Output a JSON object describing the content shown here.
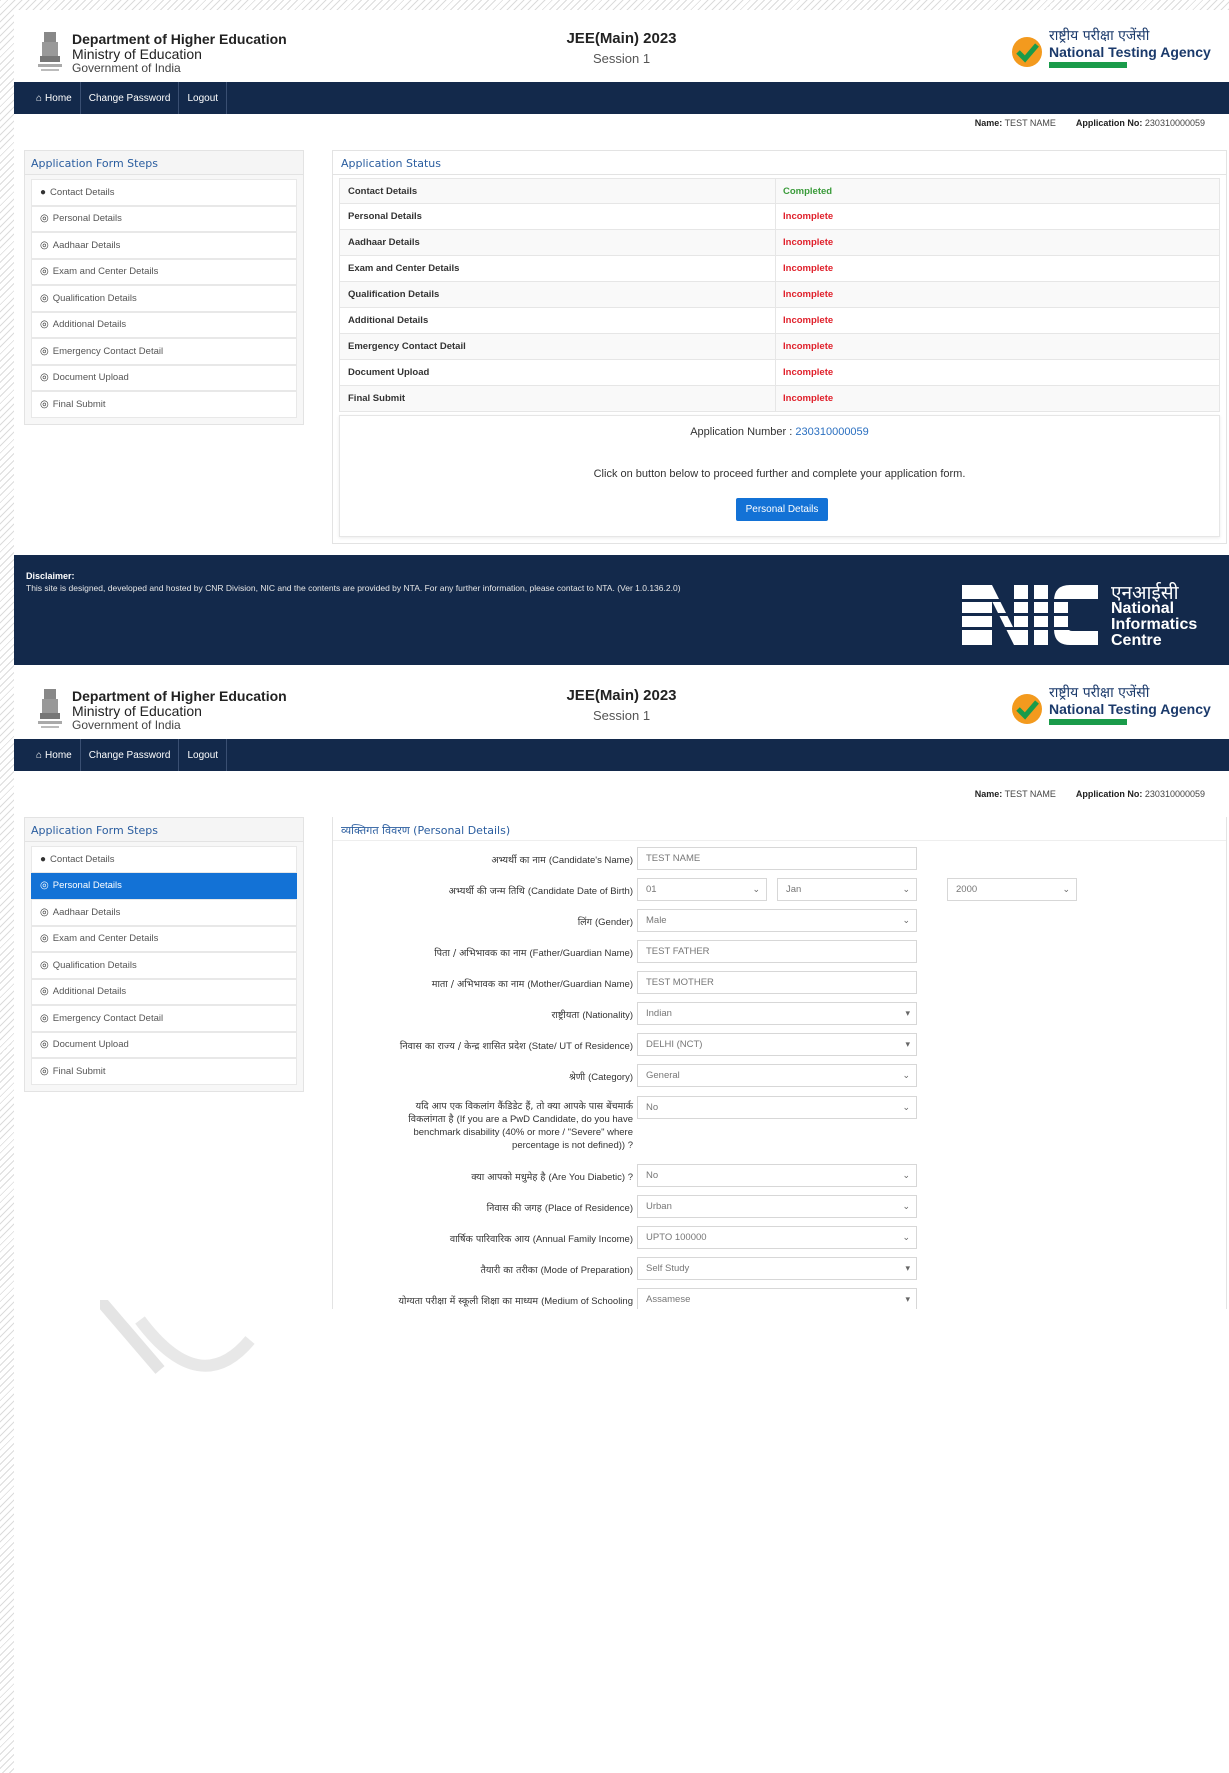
{
  "header": {
    "dept_line1": "Department of Higher Education",
    "dept_line2": "Ministry of Education",
    "dept_line3": "Government of India",
    "exam_title": "JEE(Main) 2023",
    "exam_session": "Session 1",
    "nta_hindi": "राष्ट्रीय परीक्षा एजेंसी",
    "nta_english": "National Testing Agency"
  },
  "nav": {
    "home": "Home",
    "change_password": "Change Password",
    "logout": "Logout"
  },
  "user": {
    "name_label": "Name:",
    "name_value": "TEST NAME",
    "app_no_label": "Application No:",
    "app_no_value": "230310000059"
  },
  "sidebar": {
    "title": "Application Form Steps",
    "items": [
      {
        "label": "Contact Details"
      },
      {
        "label": "Personal Details"
      },
      {
        "label": "Aadhaar Details"
      },
      {
        "label": "Exam and Center Details"
      },
      {
        "label": "Qualification Details"
      },
      {
        "label": "Additional Details"
      },
      {
        "label": "Emergency Contact Detail"
      },
      {
        "label": "Document Upload"
      },
      {
        "label": "Final Submit"
      }
    ]
  },
  "status": {
    "title": "Application Status",
    "rows": [
      {
        "step": "Contact Details",
        "state": "Completed"
      },
      {
        "step": "Personal Details",
        "state": "Incomplete"
      },
      {
        "step": "Aadhaar Details",
        "state": "Incomplete"
      },
      {
        "step": "Exam and Center Details",
        "state": "Incomplete"
      },
      {
        "step": "Qualification Details",
        "state": "Incomplete"
      },
      {
        "step": "Additional Details",
        "state": "Incomplete"
      },
      {
        "step": "Emergency Contact Detail",
        "state": "Incomplete"
      },
      {
        "step": "Document Upload",
        "state": "Incomplete"
      },
      {
        "step": "Final Submit",
        "state": "Incomplete"
      }
    ],
    "app_number_label": "Application Number :",
    "app_number_value": "230310000059",
    "instruction": "Click on button below to proceed further and complete your application form.",
    "button_label": "Personal Details"
  },
  "footer": {
    "disclaimer_title": "Disclaimer:",
    "disclaimer_text": "This site is designed, developed and hosted by CNR Division, NIC and the contents are provided by NTA. For any further information, please contact to NTA. (Ver 1.0.136.2.0)",
    "nic_logo": "NIC",
    "nic_hindi": "एनआईसी",
    "nic_line1": "National",
    "nic_line2": "Informatics",
    "nic_line3": "Centre"
  },
  "form": {
    "title_hi": "व्यक्तिगत विवरण",
    "title_en": "(Personal Details)",
    "fields": [
      {
        "label_hi": "अभ्यर्थी का नाम",
        "label_en": "(Candidate's Name)",
        "value": "TEST NAME"
      },
      {
        "label_hi": "अभ्यर्थी की जन्म तिथि",
        "label_en": "(Candidate Date of Birth)",
        "day": "01",
        "month": "Jan",
        "year": "2000"
      },
      {
        "label_hi": "लिंग",
        "label_en": "(Gender)",
        "value": "Male"
      },
      {
        "label_hi": "पिता / अभिभावक का नाम",
        "label_en": "(Father/Guardian Name)",
        "value": "TEST FATHER"
      },
      {
        "label_hi": "माता / अभिभावक का नाम",
        "label_en": "(Mother/Guardian Name)",
        "value": "TEST MOTHER"
      },
      {
        "label_hi": "राष्ट्रीयता",
        "label_en": "(Nationality)",
        "value": "Indian"
      },
      {
        "label_hi": "निवास का राज्य / केन्द्र शासित प्रदेश",
        "label_en": "(State/ UT of Residence)",
        "value": "DELHI (NCT)"
      },
      {
        "label_hi": "श्रेणी",
        "label_en": "(Category)",
        "value": "General"
      },
      {
        "label_hi_1": "यदि आप एक विकलांग कैंडिडेट हैं, तो क्या आपके पास बेंचमार्क",
        "label_hi_2": "विकलांगता है",
        "label_en_1": "(If you are a PwD Candidate, do you have",
        "label_en_2": "benchmark disability (40% or more / \"Severe\" where",
        "label_en_3": "percentage is not defined)) ?",
        "value": "No"
      },
      {
        "label_hi": "क्या आपको मधुमेह है",
        "label_en": "(Are You Diabetic) ?",
        "value": "No"
      },
      {
        "label_hi": "निवास की जगह",
        "label_en": "(Place of Residence)",
        "value": "Urban"
      },
      {
        "label_hi": "वार्षिक पारिवारिक आय",
        "label_en": "(Annual Family Income)",
        "value": "UPTO 100000"
      },
      {
        "label_hi": "तैयारी का तरीका",
        "label_en": "(Mode of Preparation)",
        "value": "Self Study"
      },
      {
        "label_hi": "योग्यता परीक्षा में स्कूली शिक्षा का माध्यम",
        "label_en": "(Medium of Schooling",
        "value": "Assamese"
      }
    ]
  },
  "colors": {
    "navy": "#13294b",
    "primary": "#1372d6",
    "completed": "#3a9b3a",
    "incomplete": "#e0202b",
    "link": "#2a5d9f"
  }
}
